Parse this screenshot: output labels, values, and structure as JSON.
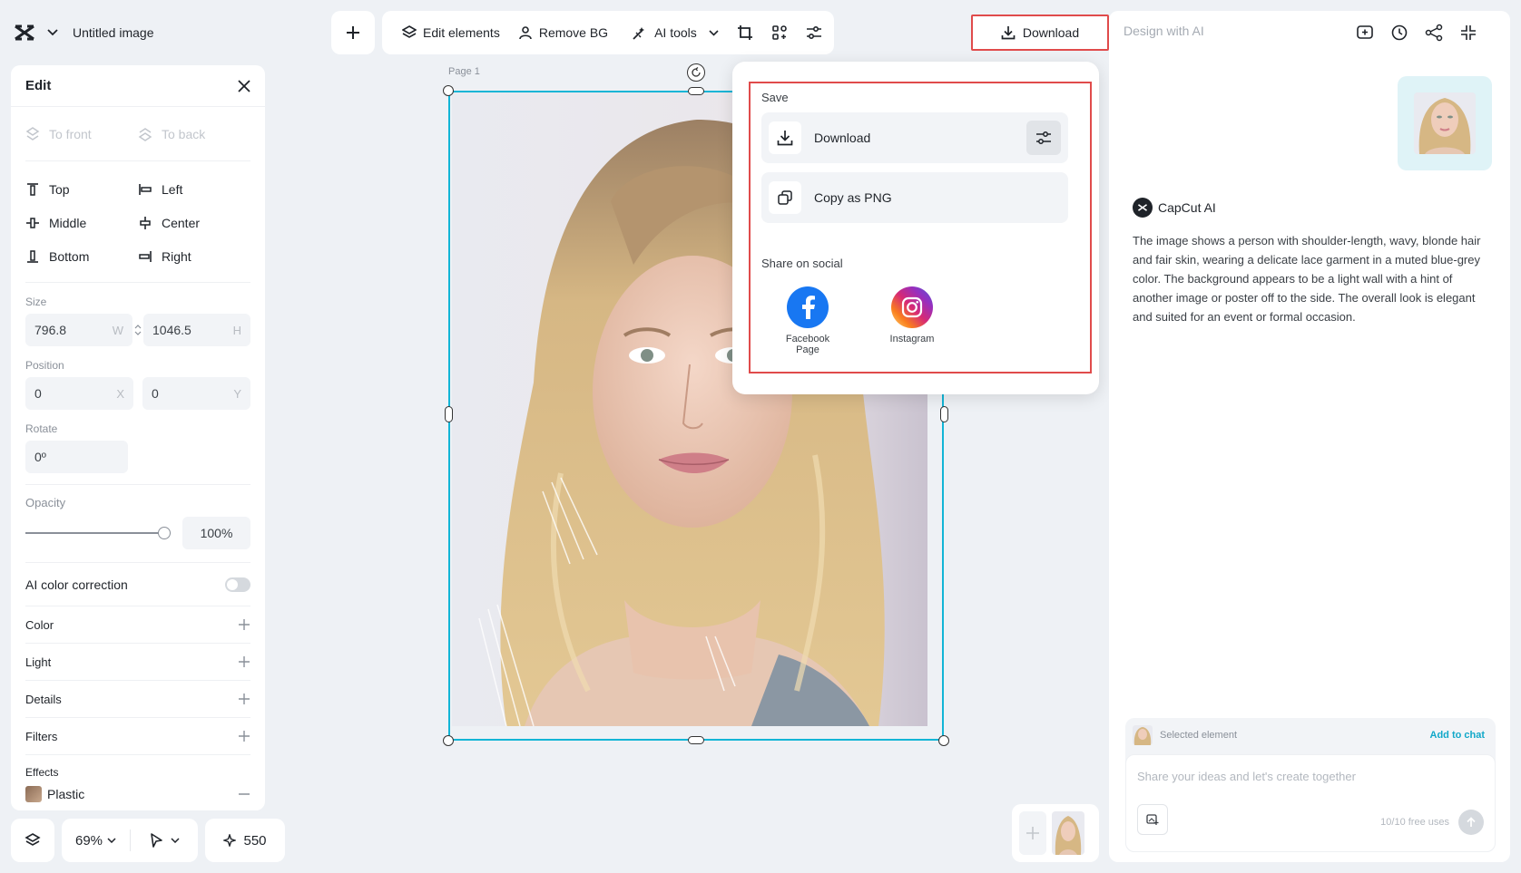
{
  "app": {
    "title": "Untitled image"
  },
  "toolbar": {
    "edit_elements": "Edit elements",
    "remove_bg": "Remove BG",
    "ai_tools": "AI tools"
  },
  "header": {
    "download_label": "Download"
  },
  "edit_panel": {
    "title": "Edit",
    "to_front": "To front",
    "to_back": "To back",
    "align": {
      "top": "Top",
      "left": "Left",
      "middle": "Middle",
      "center": "Center",
      "bottom": "Bottom",
      "right": "Right"
    },
    "size_label": "Size",
    "width": "796.8",
    "width_suffix": "W",
    "height": "1046.5",
    "height_suffix": "H",
    "position_label": "Position",
    "x": "0",
    "x_suffix": "X",
    "y": "0",
    "y_suffix": "Y",
    "rotate_label": "Rotate",
    "rotate": "0º",
    "opacity_label": "Opacity",
    "opacity": "100%",
    "opacity_value": 1.0,
    "ai_color_correction": "AI color correction",
    "ai_color_correction_on": false,
    "color": "Color",
    "light": "Light",
    "details": "Details",
    "filters": "Filters",
    "effects": "Effects",
    "effect_item": "Plastic"
  },
  "bottom_bar": {
    "zoom": "69%",
    "credits": "550"
  },
  "canvas": {
    "page_label": "Page 1"
  },
  "download_popup": {
    "save_label": "Save",
    "download": "Download",
    "copy_png": "Copy as PNG",
    "share_label": "Share on social",
    "facebook_line1": "Facebook",
    "facebook_line2": "Page",
    "instagram": "Instagram"
  },
  "ai_panel": {
    "title": "Design with AI",
    "assistant_name": "CapCut AI",
    "description": "The image shows a person with shoulder-length, wavy, blonde hair and fair skin, wearing a delicate lace garment in a muted blue-grey color. The background appears to be a light wall with a hint of another image or poster off to the side. The overall look is elegant and suited for an event or formal occasion.",
    "selected_element": "Selected element",
    "add_to_chat": "Add to chat",
    "input_placeholder": "Share your ideas and let's create together",
    "free_uses": "10/10 free uses"
  },
  "colors": {
    "accent": "#12b5d6",
    "highlight_border": "#e04b4b",
    "facebook": "#1877f2",
    "link": "#12a8c9"
  },
  "icons": [
    "capcut-logo-icon",
    "chevron-down-icon",
    "plus-icon",
    "layers-icon",
    "person-icon",
    "magic-wand-icon",
    "crop-icon",
    "scan-icon",
    "sliders-icon",
    "download-icon",
    "close-icon",
    "copy-icon",
    "facebook-icon",
    "instagram-icon",
    "new-chat-icon",
    "history-icon",
    "share-icon",
    "collapse-icon",
    "send-icon",
    "image-upload-icon",
    "sparkle-icon",
    "pointer-icon"
  ]
}
